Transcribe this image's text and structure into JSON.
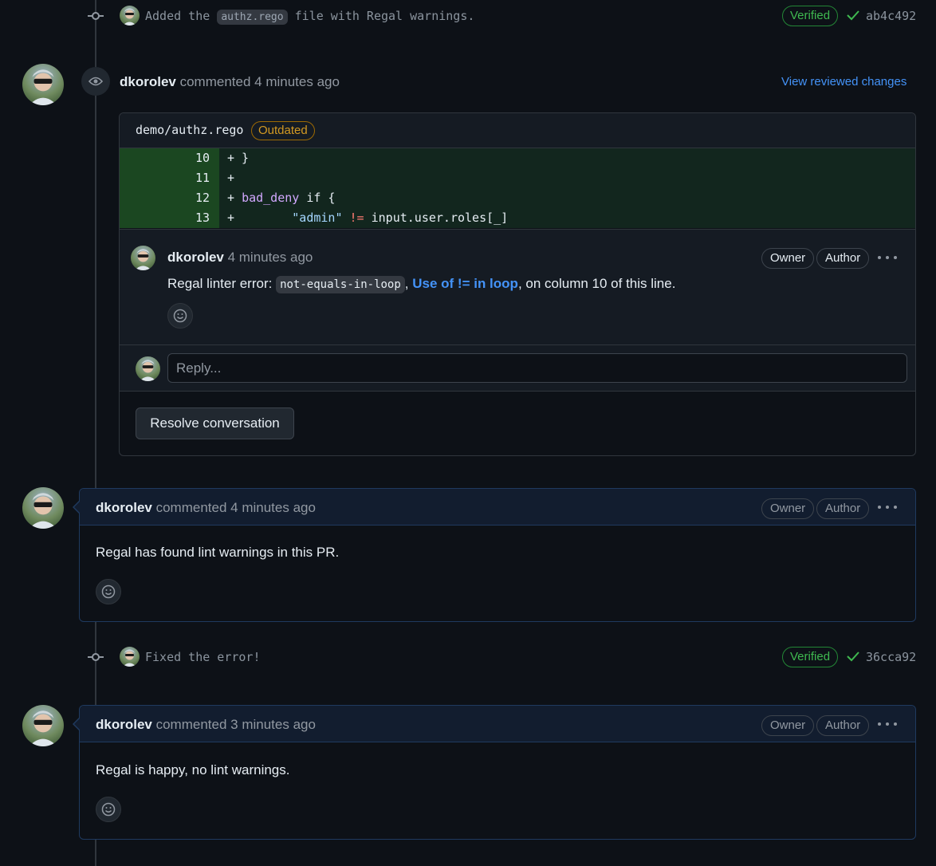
{
  "commits": [
    {
      "message_before": "Added the ",
      "message_code": "authz.rego",
      "message_after": " file with Regal warnings.",
      "verified": "Verified",
      "sha": "ab4c492"
    },
    {
      "message": "Fixed the error!",
      "verified": "Verified",
      "sha": "36cca92"
    }
  ],
  "review": {
    "author": "dkorolev",
    "action": "commented",
    "time": "4 minutes ago",
    "view_link": "View reviewed changes",
    "file_path": "demo/authz.rego",
    "outdated_label": "Outdated",
    "diff_lines": [
      {
        "num": "10",
        "sign": "+",
        "code": " }"
      },
      {
        "num": "11",
        "sign": "+",
        "code": ""
      },
      {
        "num": "12",
        "sign": "+",
        "code_ent": "bad_deny",
        "code_rest": " if {"
      },
      {
        "num": "13",
        "sign": "+",
        "indent": "        ",
        "code_str": "\"admin\"",
        "code_op": " != ",
        "code_tail": "input.user.roles[_]"
      }
    ],
    "thread": {
      "author": "dkorolev",
      "time": "4 minutes ago",
      "owner_badge": "Owner",
      "author_badge": "Author",
      "text_before": "Regal linter error: ",
      "text_code": "not-equals-in-loop",
      "text_sep": ", ",
      "text_link": "Use of != in loop",
      "text_after": ", on column 10 of this line."
    },
    "reply_placeholder": "Reply...",
    "resolve_label": "Resolve conversation"
  },
  "comments": [
    {
      "author": "dkorolev",
      "action": "commented",
      "time": "4 minutes ago",
      "owner_badge": "Owner",
      "author_badge": "Author",
      "body": "Regal has found lint warnings in this PR."
    },
    {
      "author": "dkorolev",
      "action": "commented",
      "time": "3 minutes ago",
      "owner_badge": "Owner",
      "author_badge": "Author",
      "body": "Regal is happy, no lint warnings."
    }
  ],
  "colors": {
    "background": "#0d1117",
    "accent_link": "#4493f8",
    "verified_green": "#3fb950",
    "outdated_yellow": "#d29922",
    "diff_added_bg": "#12261e"
  },
  "icons": {
    "commit": "git-commit-icon",
    "eye": "eye-icon",
    "check": "check-icon",
    "emoji": "smiley-icon",
    "more": "kebab-horizontal-icon"
  }
}
